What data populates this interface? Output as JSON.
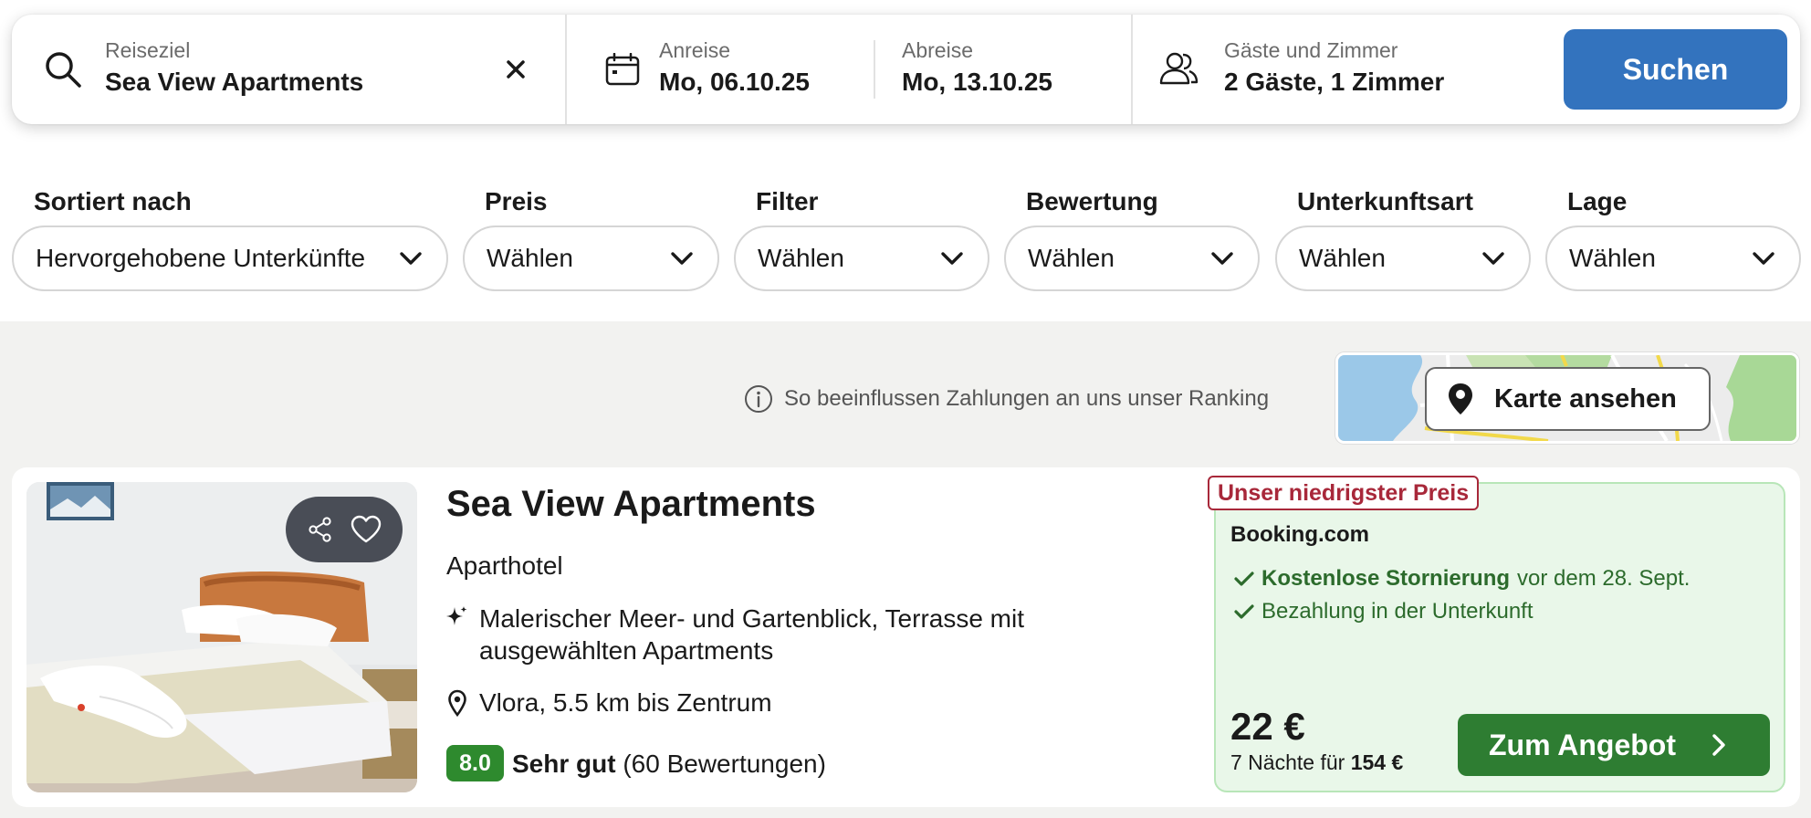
{
  "search": {
    "destination_label": "Reiseziel",
    "destination_value": "Sea View Apartments",
    "checkin_label": "Anreise",
    "checkin_value": "Mo, 06.10.25",
    "checkout_label": "Abreise",
    "checkout_value": "Mo, 13.10.25",
    "guests_label": "Gäste und Zimmer",
    "guests_value": "2 Gäste, 1 Zimmer",
    "search_button": "Suchen"
  },
  "filters": [
    {
      "label": "Sortiert nach",
      "value": "Hervorgehobene Unterkünfte"
    },
    {
      "label": "Preis",
      "value": "Wählen"
    },
    {
      "label": "Filter",
      "value": "Wählen"
    },
    {
      "label": "Bewertung",
      "value": "Wählen"
    },
    {
      "label": "Unterkunftsart",
      "value": "Wählen"
    },
    {
      "label": "Lage",
      "value": "Wählen"
    }
  ],
  "ranking_note": "So beeinflussen Zahlungen an uns unser Ranking",
  "map_button": "Karte ansehen",
  "listing": {
    "name": "Sea View Apartments",
    "type": "Aparthotel",
    "feature": "Malerischer Meer- und Gartenblick, Terrasse mit ausgewählten Apartments",
    "location": "Vlora, 5.5 km bis Zentrum",
    "rating_score": "8.0",
    "rating_label": "Sehr gut",
    "rating_count": "(60 Bewertungen)",
    "offer": {
      "tag": "Unser niedrigster Preis",
      "provider": "Booking.com",
      "benefit1_bold": "Kostenlose Stornierung",
      "benefit1_rest": "vor dem 28. Sept.",
      "benefit2": "Bezahlung in der Unterkunft",
      "price": "22 €",
      "nights_prefix": "7 Nächte für",
      "nights_total": "154 €",
      "button": "Zum Angebot"
    }
  },
  "colors": {
    "primary_blue": "#3373be",
    "deal_green": "#2e7d32",
    "rating_green": "#2e8a2e",
    "tag_red": "#a8283a",
    "offer_bg": "#e9f7e9"
  }
}
